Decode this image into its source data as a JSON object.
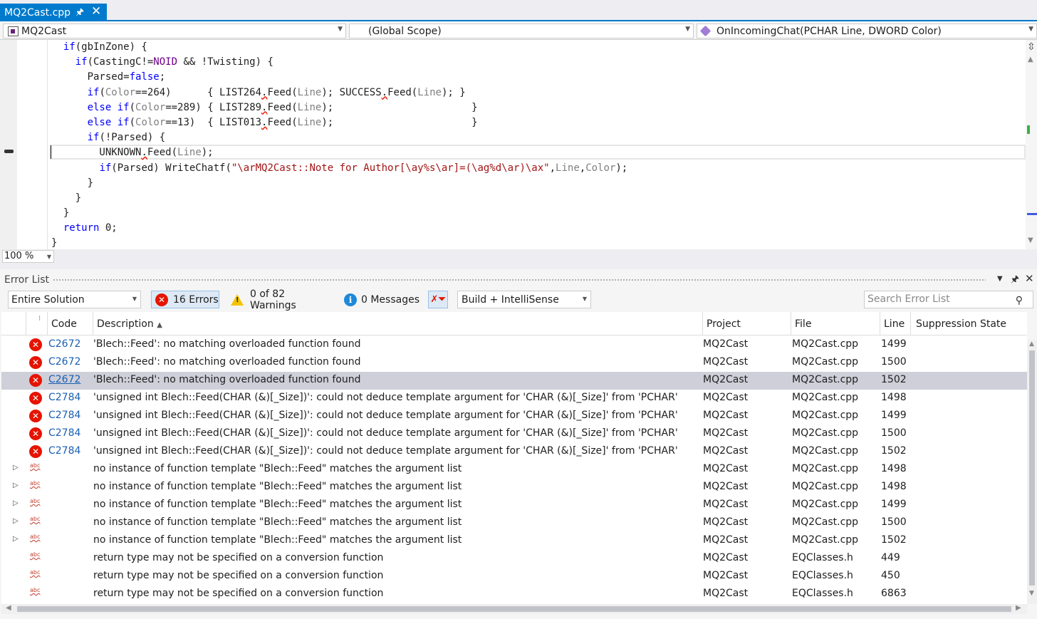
{
  "tab": {
    "title": "MQ2Cast.cpp",
    "pin": "🖈",
    "close": "✕"
  },
  "nav": {
    "project": "MQ2Cast",
    "scope": "(Global Scope)",
    "member": "OnIncomingChat(PCHAR Line, DWORD Color)"
  },
  "editor": {
    "zoom": "100 %",
    "lines": [
      [
        [
          "  ",
          ""
        ],
        [
          "if",
          "kw"
        ],
        [
          "(gbInZone) {",
          ""
        ]
      ],
      [
        [
          "    ",
          ""
        ],
        [
          "if",
          "kw"
        ],
        [
          "(CastingC!=",
          ""
        ],
        [
          "NOID",
          "mac"
        ],
        [
          " && !Twisting) {",
          ""
        ]
      ],
      [
        [
          "      Parsed=",
          ""
        ],
        [
          "false",
          "kw"
        ],
        [
          ";",
          ""
        ]
      ],
      [
        [
          "      ",
          ""
        ],
        [
          "if",
          "kw"
        ],
        [
          "(",
          ""
        ],
        [
          "Color",
          "pm"
        ],
        [
          "==264)      { LIST264",
          ""
        ],
        [
          ".",
          ""
        ],
        [
          "Feed(",
          ""
        ],
        [
          "Line",
          "pm"
        ],
        [
          "); SUCCESS",
          ""
        ],
        [
          ".",
          ""
        ],
        [
          "Feed(",
          ""
        ],
        [
          "Line",
          "pm"
        ],
        [
          "); }",
          ""
        ]
      ],
      [
        [
          "      ",
          ""
        ],
        [
          "else if",
          "kw"
        ],
        [
          "(",
          ""
        ],
        [
          "Color",
          "pm"
        ],
        [
          "==289) { LIST289",
          ""
        ],
        [
          ".",
          ""
        ],
        [
          "Feed(",
          ""
        ],
        [
          "Line",
          "pm"
        ],
        [
          ");                       }",
          ""
        ]
      ],
      [
        [
          "      ",
          ""
        ],
        [
          "else if",
          "kw"
        ],
        [
          "(",
          ""
        ],
        [
          "Color",
          "pm"
        ],
        [
          "==13)  { LIST013",
          ""
        ],
        [
          ".",
          ""
        ],
        [
          "Feed(",
          ""
        ],
        [
          "Line",
          "pm"
        ],
        [
          ");                       }",
          ""
        ]
      ],
      [
        [
          "      ",
          ""
        ],
        [
          "if",
          "kw"
        ],
        [
          "(!Parsed) {",
          ""
        ]
      ],
      [
        [
          "        UNKNOWN",
          ""
        ],
        [
          ".",
          ""
        ],
        [
          "Feed(",
          ""
        ],
        [
          "Line",
          "pm"
        ],
        [
          ");",
          ""
        ]
      ],
      [
        [
          "        ",
          ""
        ],
        [
          "if",
          "kw"
        ],
        [
          "(Parsed) WriteChatf(",
          ""
        ],
        [
          "\"\\arMQ2Cast::Note for Author[\\ay%s\\ar]=(\\ag%d\\ar)\\ax\"",
          "str"
        ],
        [
          ",",
          ""
        ],
        [
          "Line",
          "pm"
        ],
        [
          ",",
          ""
        ],
        [
          "Color",
          "pm"
        ],
        [
          ");",
          ""
        ]
      ],
      [
        [
          "      }",
          ""
        ]
      ],
      [
        [
          "    }",
          ""
        ]
      ],
      [
        [
          "  }",
          ""
        ]
      ],
      [
        [
          "  ",
          ""
        ],
        [
          "return",
          "kw"
        ],
        [
          " 0;",
          ""
        ]
      ],
      [
        [
          "}",
          ""
        ]
      ]
    ]
  },
  "errorlist": {
    "title": "Error List",
    "scope_filter": "Entire Solution",
    "errors_label": "16 Errors",
    "warnings_label": "0 of 82 Warnings",
    "messages_label": "0 Messages",
    "build_filter": "Build + IntelliSense",
    "search_placeholder": "Search Error List",
    "columns": {
      "code": "Code",
      "description": "Description",
      "project": "Project",
      "file": "File",
      "line": "Line",
      "suppression": "Suppression State"
    },
    "rows": [
      {
        "kind": "error",
        "code": "C2672",
        "description": "'Blech::Feed': no matching overloaded function found",
        "project": "MQ2Cast",
        "file": "MQ2Cast.cpp",
        "line": "1499",
        "selected": false,
        "expandable": false
      },
      {
        "kind": "error",
        "code": "C2672",
        "description": "'Blech::Feed': no matching overloaded function found",
        "project": "MQ2Cast",
        "file": "MQ2Cast.cpp",
        "line": "1500",
        "selected": false,
        "expandable": false
      },
      {
        "kind": "error",
        "code": "C2672",
        "description": "'Blech::Feed': no matching overloaded function found",
        "project": "MQ2Cast",
        "file": "MQ2Cast.cpp",
        "line": "1502",
        "selected": true,
        "expandable": false
      },
      {
        "kind": "error",
        "code": "C2784",
        "description": "'unsigned int Blech::Feed(CHAR (&)[_Size])': could not deduce template argument for 'CHAR (&)[_Size]' from 'PCHAR'",
        "project": "MQ2Cast",
        "file": "MQ2Cast.cpp",
        "line": "1498",
        "selected": false,
        "expandable": false
      },
      {
        "kind": "error",
        "code": "C2784",
        "description": "'unsigned int Blech::Feed(CHAR (&)[_Size])': could not deduce template argument for 'CHAR (&)[_Size]' from 'PCHAR'",
        "project": "MQ2Cast",
        "file": "MQ2Cast.cpp",
        "line": "1499",
        "selected": false,
        "expandable": false
      },
      {
        "kind": "error",
        "code": "C2784",
        "description": "'unsigned int Blech::Feed(CHAR (&)[_Size])': could not deduce template argument for 'CHAR (&)[_Size]' from 'PCHAR'",
        "project": "MQ2Cast",
        "file": "MQ2Cast.cpp",
        "line": "1500",
        "selected": false,
        "expandable": false
      },
      {
        "kind": "error",
        "code": "C2784",
        "description": "'unsigned int Blech::Feed(CHAR (&)[_Size])': could not deduce template argument for 'CHAR (&)[_Size]' from 'PCHAR'",
        "project": "MQ2Cast",
        "file": "MQ2Cast.cpp",
        "line": "1502",
        "selected": false,
        "expandable": false
      },
      {
        "kind": "intellisense",
        "code": "",
        "description": "no instance of function template \"Blech::Feed\" matches the argument list",
        "project": "MQ2Cast",
        "file": "MQ2Cast.cpp",
        "line": "1498",
        "selected": false,
        "expandable": true
      },
      {
        "kind": "intellisense",
        "code": "",
        "description": "no instance of function template \"Blech::Feed\" matches the argument list",
        "project": "MQ2Cast",
        "file": "MQ2Cast.cpp",
        "line": "1498",
        "selected": false,
        "expandable": true
      },
      {
        "kind": "intellisense",
        "code": "",
        "description": "no instance of function template \"Blech::Feed\" matches the argument list",
        "project": "MQ2Cast",
        "file": "MQ2Cast.cpp",
        "line": "1499",
        "selected": false,
        "expandable": true
      },
      {
        "kind": "intellisense",
        "code": "",
        "description": "no instance of function template \"Blech::Feed\" matches the argument list",
        "project": "MQ2Cast",
        "file": "MQ2Cast.cpp",
        "line": "1500",
        "selected": false,
        "expandable": true
      },
      {
        "kind": "intellisense",
        "code": "",
        "description": "no instance of function template \"Blech::Feed\" matches the argument list",
        "project": "MQ2Cast",
        "file": "MQ2Cast.cpp",
        "line": "1502",
        "selected": false,
        "expandable": true
      },
      {
        "kind": "intellisense",
        "code": "",
        "description": "return type may not be specified on a conversion function",
        "project": "MQ2Cast",
        "file": "EQClasses.h",
        "line": "449",
        "selected": false,
        "expandable": false
      },
      {
        "kind": "intellisense",
        "code": "",
        "description": "return type may not be specified on a conversion function",
        "project": "MQ2Cast",
        "file": "EQClasses.h",
        "line": "450",
        "selected": false,
        "expandable": false
      },
      {
        "kind": "intellisense",
        "code": "",
        "description": "return type may not be specified on a conversion function",
        "project": "MQ2Cast",
        "file": "EQClasses.h",
        "line": "6863",
        "selected": false,
        "expandable": false
      }
    ]
  },
  "icons": {
    "error": "error-icon",
    "warning": "warning-icon",
    "info": "info-icon",
    "intellisense": "intellisense-squiggle-icon"
  },
  "colors": {
    "accent": "#007acc",
    "error": "#e51400",
    "selection": "#cfcfd9",
    "keyword": "#0000ff",
    "string": "#a31515"
  }
}
